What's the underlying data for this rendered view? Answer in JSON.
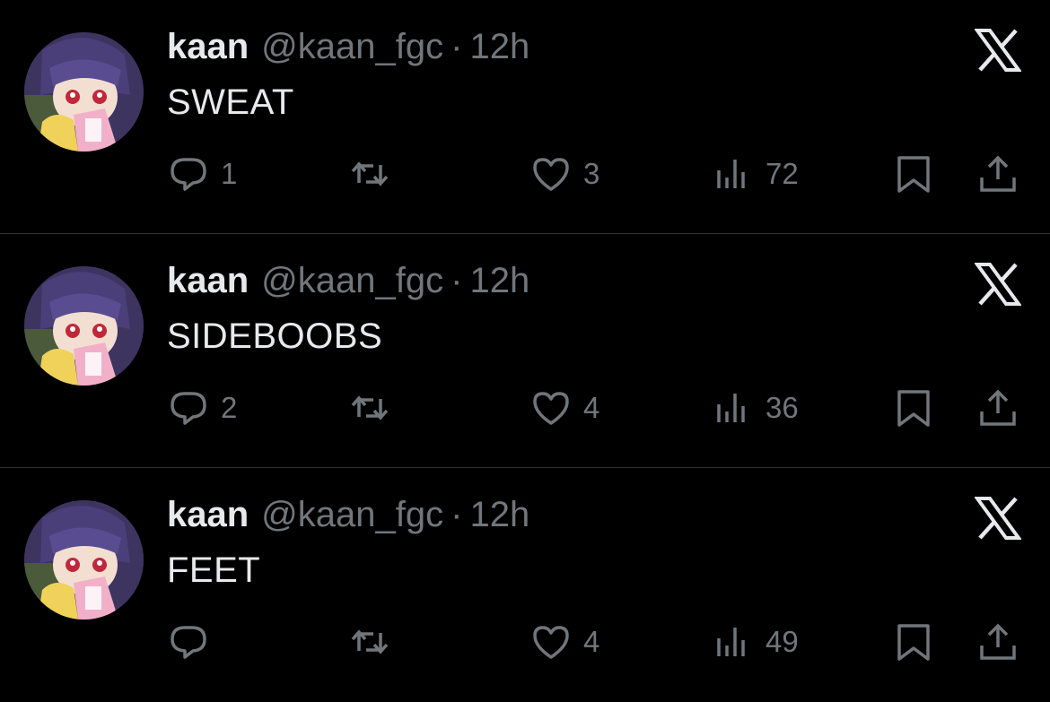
{
  "tweets": [
    {
      "name": "kaan",
      "handle": "@kaan_fgc",
      "separator": "·",
      "time": "12h",
      "text": "SWEAT",
      "replies": "1",
      "likes": "3",
      "views": "72"
    },
    {
      "name": "kaan",
      "handle": "@kaan_fgc",
      "separator": "·",
      "time": "12h",
      "text": "SIDEBOOBS",
      "replies": "2",
      "likes": "4",
      "views": "36"
    },
    {
      "name": "kaan",
      "handle": "@kaan_fgc",
      "separator": "·",
      "time": "12h",
      "text": "FEET",
      "replies": "",
      "likes": "4",
      "views": "49"
    }
  ],
  "icons": {
    "reply": "reply-icon",
    "retweet": "retweet-icon",
    "like": "heart-icon",
    "views": "views-icon",
    "bookmark": "bookmark-icon",
    "share": "share-icon",
    "logo": "x-logo-icon"
  },
  "colors": {
    "background": "#000000",
    "text": "#e7e9ea",
    "muted": "#71767b",
    "divider": "#2f3336"
  }
}
